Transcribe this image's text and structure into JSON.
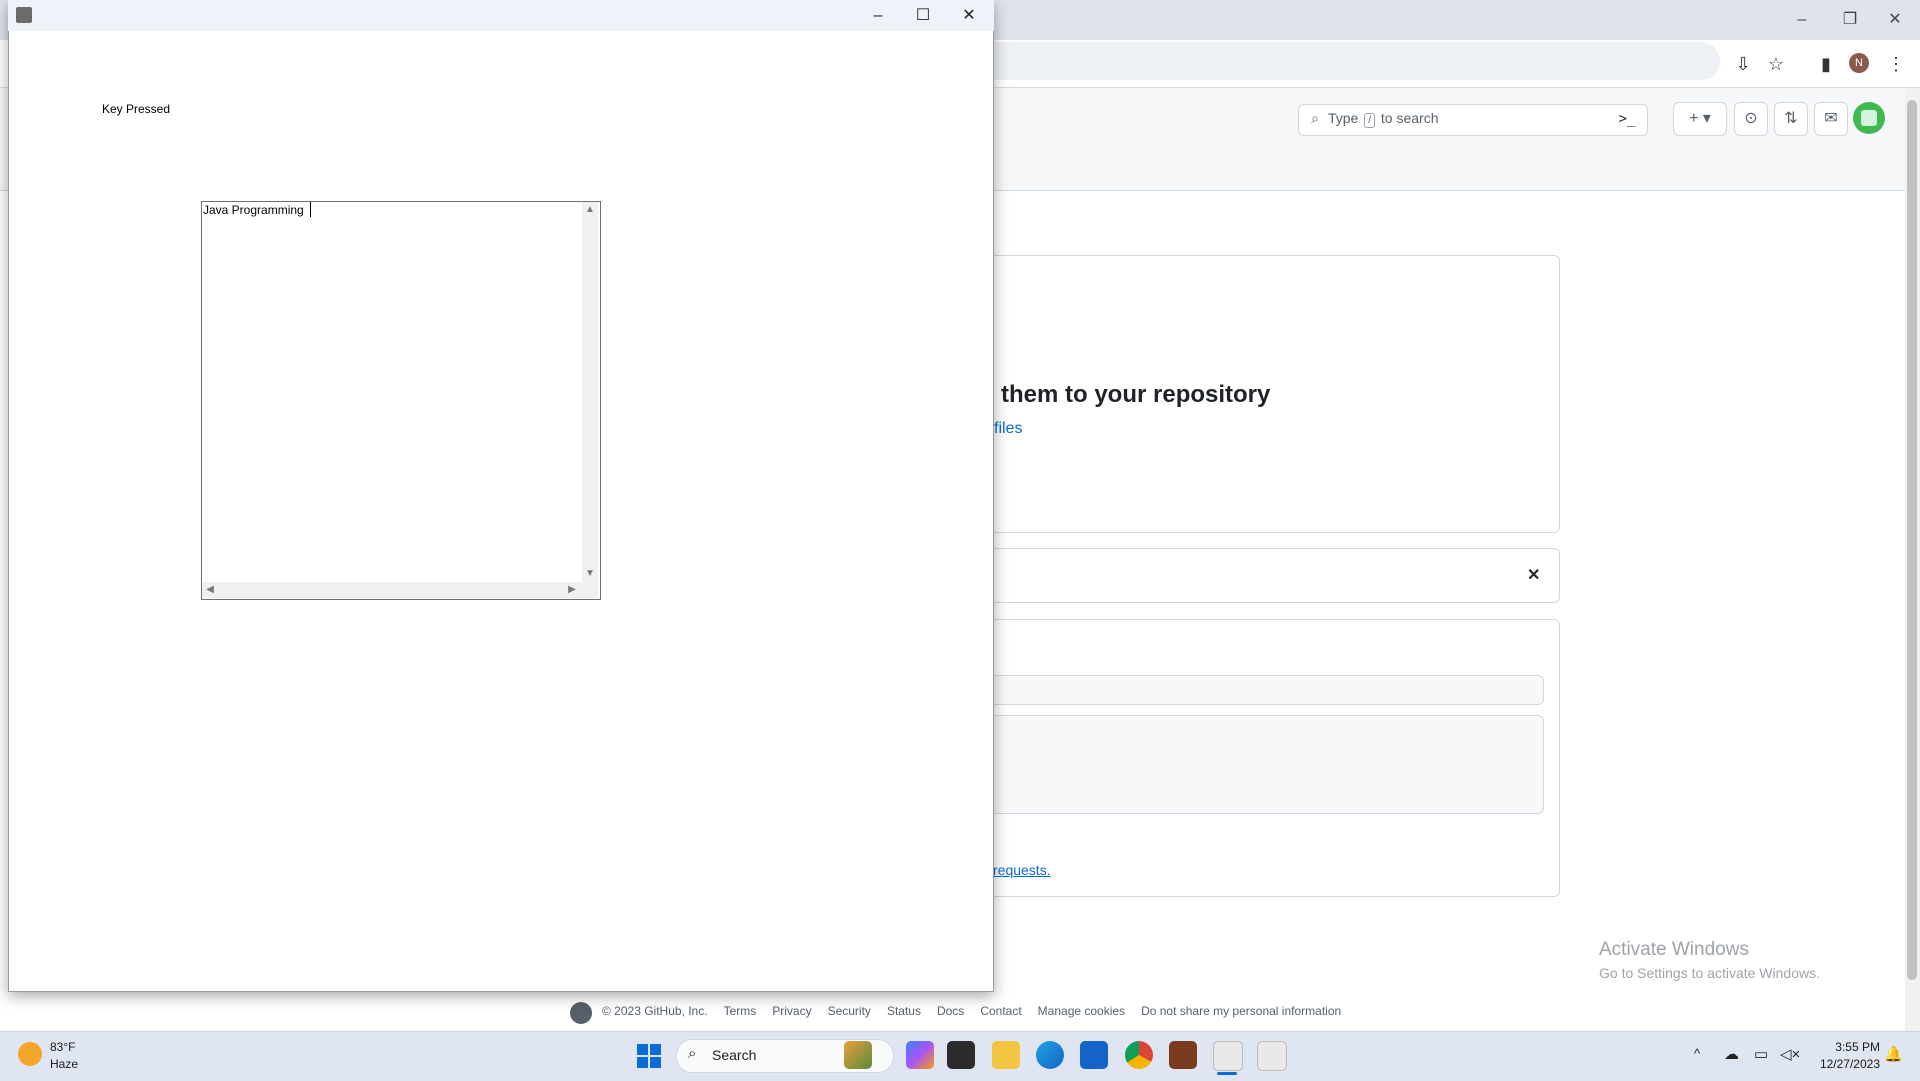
{
  "browser": {
    "github": {
      "search_prefix": "Type",
      "search_key": "/",
      "search_suffix": "to search",
      "heading": "them to your repository",
      "files_link": "files",
      "close_symbol": "✕",
      "requests_link": "requests.",
      "footer": {
        "copyright": "© 2023 GitHub, Inc.",
        "links": [
          "Terms",
          "Privacy",
          "Security",
          "Status",
          "Docs",
          "Contact",
          "Manage cookies",
          "Do not share my personal information"
        ]
      }
    },
    "profile_initial": "N",
    "activate": {
      "title": "Activate Windows",
      "subtitle": "Go to Settings to activate Windows."
    }
  },
  "java_window": {
    "label": "Key Pressed",
    "textarea_value": "Java Programming "
  },
  "taskbar": {
    "weather_temp": "83°F",
    "weather_condition": "Haze",
    "search_label": "Search",
    "time": "3:55 PM",
    "date": "12/27/2023",
    "apps": [
      "copilot-icon",
      "file-explorer-icon",
      "folder-icon",
      "edge-icon",
      "store-icon",
      "chrome-icon",
      "app-icon",
      "java-icon",
      "java-icon"
    ]
  },
  "colors": {
    "accent": "#0a6cd6",
    "github_link": "#0969da",
    "window_title_bg": "#eef3fa"
  }
}
